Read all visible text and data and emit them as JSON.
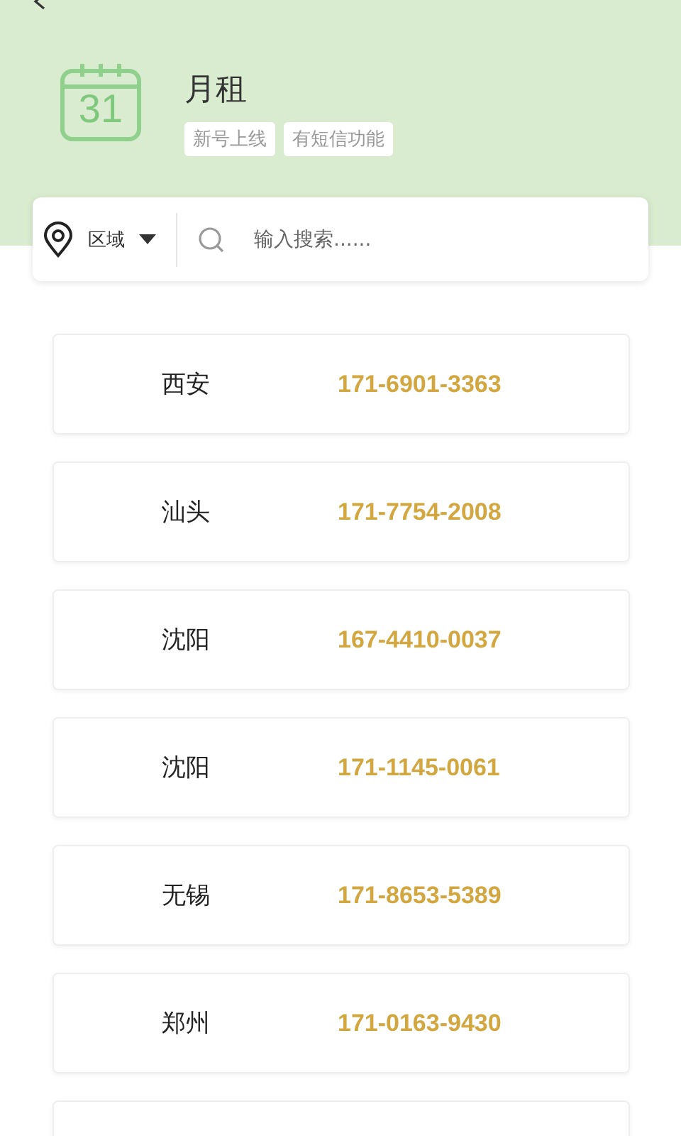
{
  "header": {
    "title": "月租",
    "tags": [
      "新号上线",
      "有短信功能"
    ],
    "calendar_day": "31"
  },
  "filter": {
    "region": "区域",
    "placeholder": "输入搜索......"
  },
  "numbers": [
    {
      "city": "西安",
      "number": "171-6901-3363"
    },
    {
      "city": "汕头",
      "number": "171-7754-2008"
    },
    {
      "city": "沈阳",
      "number": "167-4410-0037"
    },
    {
      "city": "沈阳",
      "number": "171-1145-0061"
    },
    {
      "city": "无锡",
      "number": "171-8653-5389"
    },
    {
      "city": "郑州",
      "number": "171-0163-9430"
    }
  ]
}
